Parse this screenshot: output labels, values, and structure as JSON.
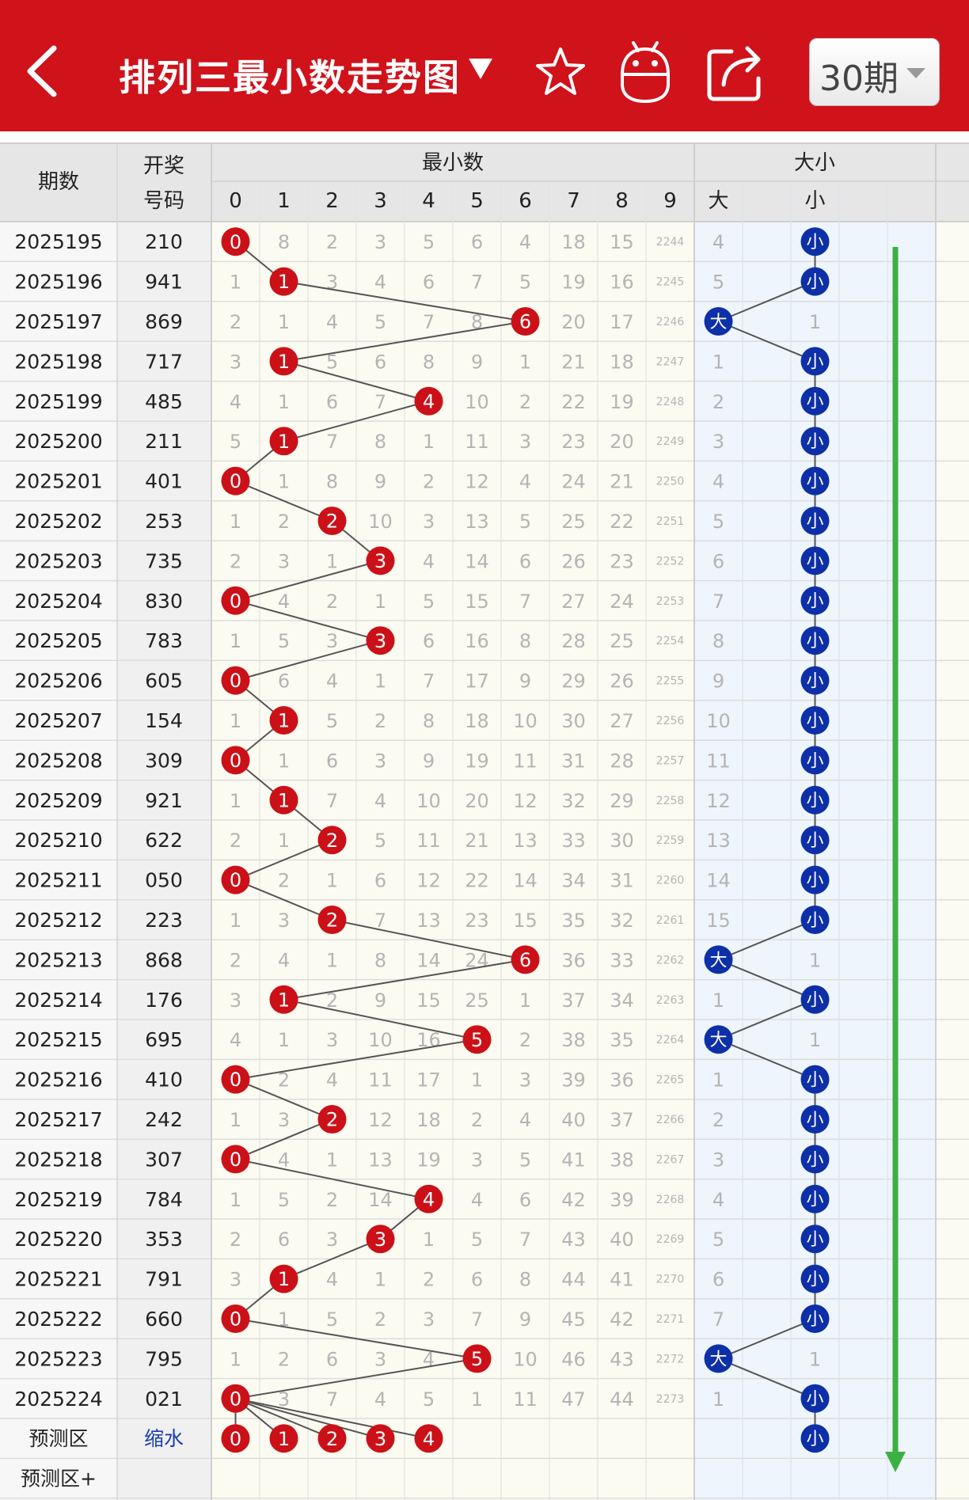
{
  "header": {
    "title": "排列三最小数走势图",
    "period_label": "30期",
    "icons": [
      "back-arrow-icon",
      "dropdown-caret-icon",
      "star-icon",
      "robot-icon",
      "share-icon",
      "chevron-down-icon"
    ]
  },
  "colors": {
    "brand_red": "#d0121b",
    "ball_red": "#cc1018",
    "ball_blue": "#0d2fa8",
    "trend_green": "#3cb043",
    "line": "#555555"
  },
  "table": {
    "col_issue": "期数",
    "col_draw_1": "开奖",
    "col_draw_2": "号码",
    "group_min": "最小数",
    "group_size": "大小",
    "digits": [
      "0",
      "1",
      "2",
      "3",
      "4",
      "5",
      "6",
      "7",
      "8",
      "9"
    ],
    "size_labels": [
      "大",
      "小"
    ],
    "rows": [
      {
        "issue": "2025195",
        "draw": "210",
        "min": 0,
        "miss": [
          "0",
          "8",
          "2",
          "3",
          "5",
          "6",
          "4",
          "18",
          "15",
          "2244"
        ],
        "size": "小",
        "size_miss": "4"
      },
      {
        "issue": "2025196",
        "draw": "941",
        "min": 1,
        "miss": [
          "1",
          "1",
          "3",
          "4",
          "6",
          "7",
          "5",
          "19",
          "16",
          "2245"
        ],
        "size": "小",
        "size_miss": "5"
      },
      {
        "issue": "2025197",
        "draw": "869",
        "min": 6,
        "miss": [
          "2",
          "1",
          "4",
          "5",
          "7",
          "8",
          "6",
          "20",
          "17",
          "2246"
        ],
        "size": "大",
        "size_miss": "1"
      },
      {
        "issue": "2025198",
        "draw": "717",
        "min": 1,
        "miss": [
          "3",
          "1",
          "5",
          "6",
          "8",
          "9",
          "1",
          "21",
          "18",
          "2247"
        ],
        "size": "小",
        "size_miss": "1"
      },
      {
        "issue": "2025199",
        "draw": "485",
        "min": 4,
        "miss": [
          "4",
          "1",
          "6",
          "7",
          "4",
          "10",
          "2",
          "22",
          "19",
          "2248"
        ],
        "size": "小",
        "size_miss": "2"
      },
      {
        "issue": "2025200",
        "draw": "211",
        "min": 1,
        "miss": [
          "5",
          "1",
          "7",
          "8",
          "1",
          "11",
          "3",
          "23",
          "20",
          "2249"
        ],
        "size": "小",
        "size_miss": "3"
      },
      {
        "issue": "2025201",
        "draw": "401",
        "min": 0,
        "miss": [
          "0",
          "1",
          "8",
          "9",
          "2",
          "12",
          "4",
          "24",
          "21",
          "2250"
        ],
        "size": "小",
        "size_miss": "4"
      },
      {
        "issue": "2025202",
        "draw": "253",
        "min": 2,
        "miss": [
          "1",
          "2",
          "2",
          "10",
          "3",
          "13",
          "5",
          "25",
          "22",
          "2251"
        ],
        "size": "小",
        "size_miss": "5"
      },
      {
        "issue": "2025203",
        "draw": "735",
        "min": 3,
        "miss": [
          "2",
          "3",
          "1",
          "3",
          "4",
          "14",
          "6",
          "26",
          "23",
          "2252"
        ],
        "size": "小",
        "size_miss": "6"
      },
      {
        "issue": "2025204",
        "draw": "830",
        "min": 0,
        "miss": [
          "0",
          "4",
          "2",
          "1",
          "5",
          "15",
          "7",
          "27",
          "24",
          "2253"
        ],
        "size": "小",
        "size_miss": "7"
      },
      {
        "issue": "2025205",
        "draw": "783",
        "min": 3,
        "miss": [
          "1",
          "5",
          "3",
          "3",
          "6",
          "16",
          "8",
          "28",
          "25",
          "2254"
        ],
        "size": "小",
        "size_miss": "8"
      },
      {
        "issue": "2025206",
        "draw": "605",
        "min": 0,
        "miss": [
          "0",
          "6",
          "4",
          "1",
          "7",
          "17",
          "9",
          "29",
          "26",
          "2255"
        ],
        "size": "小",
        "size_miss": "9"
      },
      {
        "issue": "2025207",
        "draw": "154",
        "min": 1,
        "miss": [
          "1",
          "1",
          "5",
          "2",
          "8",
          "18",
          "10",
          "30",
          "27",
          "2256"
        ],
        "size": "小",
        "size_miss": "10"
      },
      {
        "issue": "2025208",
        "draw": "309",
        "min": 0,
        "miss": [
          "0",
          "1",
          "6",
          "3",
          "9",
          "19",
          "11",
          "31",
          "28",
          "2257"
        ],
        "size": "小",
        "size_miss": "11"
      },
      {
        "issue": "2025209",
        "draw": "921",
        "min": 1,
        "miss": [
          "1",
          "1",
          "7",
          "4",
          "10",
          "20",
          "12",
          "32",
          "29",
          "2258"
        ],
        "size": "小",
        "size_miss": "12"
      },
      {
        "issue": "2025210",
        "draw": "622",
        "min": 2,
        "miss": [
          "2",
          "1",
          "2",
          "5",
          "11",
          "21",
          "13",
          "33",
          "30",
          "2259"
        ],
        "size": "小",
        "size_miss": "13"
      },
      {
        "issue": "2025211",
        "draw": "050",
        "min": 0,
        "miss": [
          "0",
          "2",
          "1",
          "6",
          "12",
          "22",
          "14",
          "34",
          "31",
          "2260"
        ],
        "size": "小",
        "size_miss": "14"
      },
      {
        "issue": "2025212",
        "draw": "223",
        "min": 2,
        "miss": [
          "1",
          "3",
          "2",
          "7",
          "13",
          "23",
          "15",
          "35",
          "32",
          "2261"
        ],
        "size": "小",
        "size_miss": "15"
      },
      {
        "issue": "2025213",
        "draw": "868",
        "min": 6,
        "miss": [
          "2",
          "4",
          "1",
          "8",
          "14",
          "24",
          "6",
          "36",
          "33",
          "2262"
        ],
        "size": "大",
        "size_miss": "1"
      },
      {
        "issue": "2025214",
        "draw": "176",
        "min": 1,
        "miss": [
          "3",
          "1",
          "2",
          "9",
          "15",
          "25",
          "1",
          "37",
          "34",
          "2263"
        ],
        "size": "小",
        "size_miss": "1"
      },
      {
        "issue": "2025215",
        "draw": "695",
        "min": 5,
        "miss": [
          "4",
          "1",
          "3",
          "10",
          "16",
          "5",
          "2",
          "38",
          "35",
          "2264"
        ],
        "size": "大",
        "size_miss": "1"
      },
      {
        "issue": "2025216",
        "draw": "410",
        "min": 0,
        "miss": [
          "0",
          "2",
          "4",
          "11",
          "17",
          "1",
          "3",
          "39",
          "36",
          "2265"
        ],
        "size": "小",
        "size_miss": "1"
      },
      {
        "issue": "2025217",
        "draw": "242",
        "min": 2,
        "miss": [
          "1",
          "3",
          "2",
          "12",
          "18",
          "2",
          "4",
          "40",
          "37",
          "2266"
        ],
        "size": "小",
        "size_miss": "2"
      },
      {
        "issue": "2025218",
        "draw": "307",
        "min": 0,
        "miss": [
          "0",
          "4",
          "1",
          "13",
          "19",
          "3",
          "5",
          "41",
          "38",
          "2267"
        ],
        "size": "小",
        "size_miss": "3"
      },
      {
        "issue": "2025219",
        "draw": "784",
        "min": 4,
        "miss": [
          "1",
          "5",
          "2",
          "14",
          "4",
          "4",
          "6",
          "42",
          "39",
          "2268"
        ],
        "size": "小",
        "size_miss": "4"
      },
      {
        "issue": "2025220",
        "draw": "353",
        "min": 3,
        "miss": [
          "2",
          "6",
          "3",
          "3",
          "1",
          "5",
          "7",
          "43",
          "40",
          "2269"
        ],
        "size": "小",
        "size_miss": "5"
      },
      {
        "issue": "2025221",
        "draw": "791",
        "min": 1,
        "miss": [
          "3",
          "1",
          "4",
          "1",
          "2",
          "6",
          "8",
          "44",
          "41",
          "2270"
        ],
        "size": "小",
        "size_miss": "6"
      },
      {
        "issue": "2025222",
        "draw": "660",
        "min": 0,
        "miss": [
          "0",
          "1",
          "5",
          "2",
          "3",
          "7",
          "9",
          "45",
          "42",
          "2271"
        ],
        "size": "小",
        "size_miss": "7"
      },
      {
        "issue": "2025223",
        "draw": "795",
        "min": 5,
        "miss": [
          "1",
          "2",
          "6",
          "3",
          "4",
          "5",
          "10",
          "46",
          "43",
          "2272"
        ],
        "size": "大",
        "size_miss": "1"
      },
      {
        "issue": "2025224",
        "draw": "021",
        "min": 0,
        "miss": [
          "0",
          "3",
          "7",
          "4",
          "5",
          "1",
          "11",
          "47",
          "44",
          "2273"
        ],
        "size": "小",
        "size_miss": "1"
      }
    ],
    "predict_label": "预测区",
    "predict_link": "缩水",
    "predict_balls": [
      "0",
      "1",
      "2",
      "3",
      "4"
    ],
    "predict_size": "小",
    "predict_plus_label": "预测区+"
  }
}
